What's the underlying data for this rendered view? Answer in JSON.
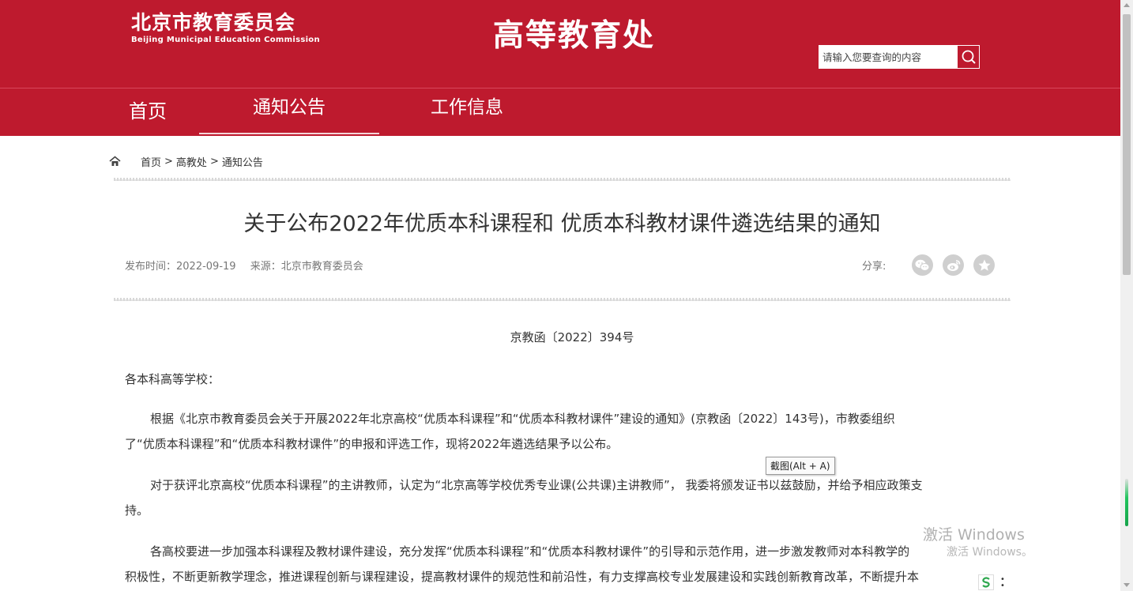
{
  "header": {
    "logo_cn": "北京市教育委员会",
    "logo_en": "Beijing Municipal Education Commission",
    "site_title": "高等教育处",
    "search_placeholder": "请输入您要查询的内容"
  },
  "nav": {
    "items": [
      {
        "label": "首页",
        "active": false
      },
      {
        "label": "通知公告",
        "active": true
      },
      {
        "label": "工作信息",
        "active": false
      }
    ]
  },
  "breadcrumb": {
    "items": [
      "首页",
      "高教处",
      "通知公告"
    ],
    "separator": ">"
  },
  "article": {
    "title": "关于公布2022年优质本科课程和 优质本科教材课件遴选结果的通知",
    "publish_time": "发布时间：2022-09-19",
    "source": "来源：北京市教育委员会",
    "share_label": "分享:",
    "share_icons": [
      "wechat-icon",
      "weibo-icon",
      "favorite-star-icon"
    ],
    "doc_number": "京教函〔2022〕394号",
    "salutation": "各本科高等学校：",
    "paragraphs": [
      [
        "根据《北京市教育委员会关于开展2022年北京高校“优质本科课程”和“优质本科教材课件”建设的通知》(京教函〔2022〕143号)，市教委组织",
        "了“优质本科课程”和“优质本科教材课件”的申报和评选工作，现将2022年遴选结果予以公布。"
      ],
      [
        "对于获评北京高校“优质本科课程”的主讲教师，认定为“北京高等学校优秀专业课(公共课)主讲教师”， 我委将颁发证书以兹鼓励，并给予相应政策支",
        "持。"
      ],
      [
        "各高校要进一步加强本科课程及教材课件建设，充分发挥“优质本科课程”和“优质本科教材课件”的引导和示范作用，进一步激发教师对本科教学的",
        "积极性，不断更新教学理念，推进课程创新与课程建设，提高教材课件的规范性和前沿性，有力支撑高校专业发展建设和实践创新教育改革，不断提升本"
      ]
    ]
  },
  "overlay": {
    "tooltip": "截图(Alt + A)",
    "watermark_title": "激活 Windows",
    "watermark_sub": "激活 Windows。"
  },
  "colors": {
    "brand_red": "#be1a2e",
    "icon_gray": "#cfcfcf"
  }
}
